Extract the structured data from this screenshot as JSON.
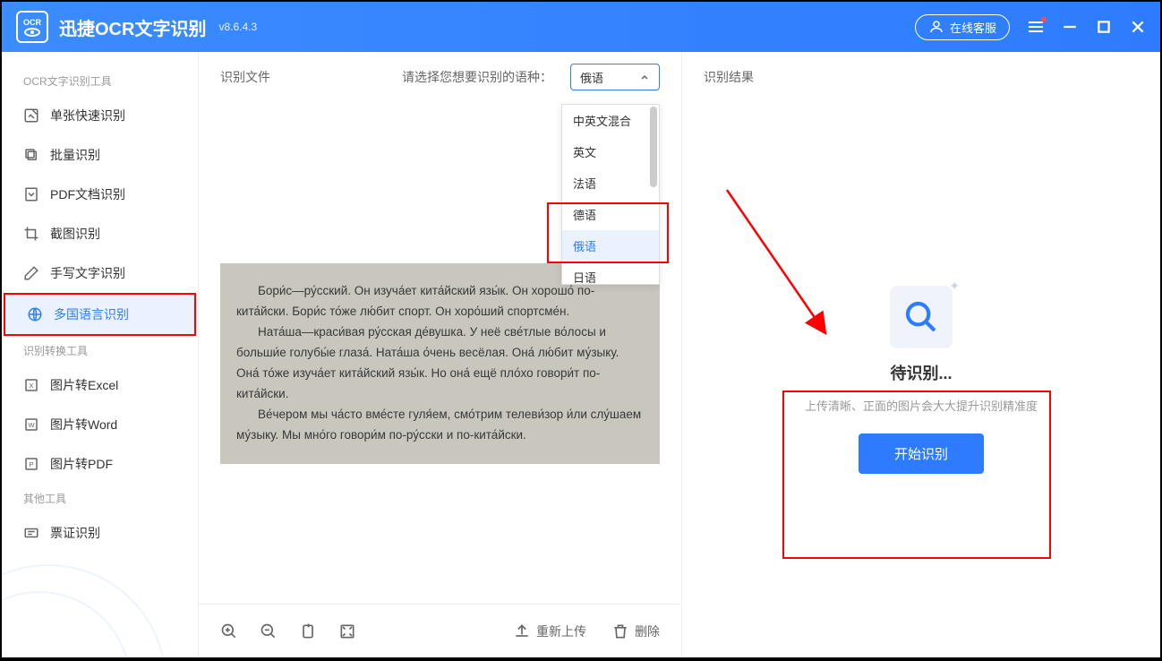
{
  "titlebar": {
    "logo_text": "OCR",
    "app_name": "迅捷OCR文字识别",
    "version": "v8.6.4.3",
    "customer_service": "在线客服"
  },
  "sidebar": {
    "groups": [
      {
        "header": "OCR文字识别工具",
        "items": [
          {
            "label": "单张快速识别",
            "icon": "image-fast"
          },
          {
            "label": "批量识别",
            "icon": "copy"
          },
          {
            "label": "PDF文档识别",
            "icon": "pdf"
          },
          {
            "label": "截图识别",
            "icon": "crop"
          },
          {
            "label": "手写文字识别",
            "icon": "pen"
          },
          {
            "label": "多国语言识别",
            "icon": "globe",
            "active": true
          }
        ]
      },
      {
        "header": "识别转换工具",
        "items": [
          {
            "label": "图片转Excel",
            "icon": "x"
          },
          {
            "label": "图片转Word",
            "icon": "w"
          },
          {
            "label": "图片转PDF",
            "icon": "p"
          }
        ]
      },
      {
        "header": "其他工具",
        "items": [
          {
            "label": "票证识别",
            "icon": "ticket"
          }
        ]
      }
    ]
  },
  "left_panel": {
    "title": "识别文件",
    "lang_label": "请选择您想要识别的语种：",
    "lang_selected": "俄语",
    "dropdown": [
      "中英文混合",
      "英文",
      "法语",
      "德语",
      "俄语",
      "日语"
    ],
    "document_text": {
      "p1": "Бори́с—ру́сский. Он изуча́ет кита́йский язы́к. Он хорошо́ по-кита́йски. Бори́с то́же лю́бит спорт. Он хоро́ший спортсме́н.",
      "p2": "Ната́ша—краси́вая ру́сская де́вушка. У неё све́тлые во́лосы и больши́е голубы́е глаза́. Ната́ша о́чень весёлая. Она́ лю́бит му́зыку. Она́ то́же изуча́ет кита́йский язы́к. Но она́ ещё пло́хо говори́т по-кита́йски.",
      "p3": "Ве́чером мы ча́сто вме́сте гуля́ем, смо́трим телеви́зор и́ли слу́шаем му́зыку. Мы мно́го говори́м по-ру́сски и по-кита́йски."
    },
    "toolbar": {
      "reupload": "重新上传",
      "delete": "删除"
    }
  },
  "right_panel": {
    "title": "识别结果",
    "placeholder_title": "待识别...",
    "placeholder_hint": "上传清晰、正面的图片会大大提升识别精准度",
    "start_button": "开始识别"
  }
}
